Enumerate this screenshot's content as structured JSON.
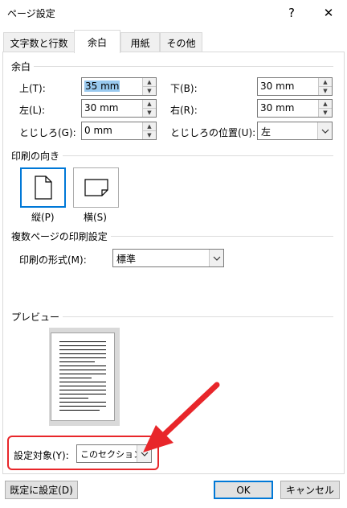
{
  "window": {
    "title": "ページ設定",
    "help_label": "?",
    "close_label": "✕"
  },
  "tabs": [
    {
      "label": "文字数と行数",
      "active": false
    },
    {
      "label": "余白",
      "active": true
    },
    {
      "label": "用紙",
      "active": false
    },
    {
      "label": "その他",
      "active": false
    }
  ],
  "margins": {
    "section_label": "余白",
    "top": {
      "label": "上(T):",
      "value": "35 mm"
    },
    "bottom": {
      "label": "下(B):",
      "value": "30 mm"
    },
    "left": {
      "label": "左(L):",
      "value": "30 mm"
    },
    "right": {
      "label": "右(R):",
      "value": "30 mm"
    },
    "gutter": {
      "label": "とじしろ(G):",
      "value": "0 mm"
    },
    "gutter_pos": {
      "label": "とじしろの位置(U):",
      "value": "左"
    }
  },
  "orientation": {
    "section_label": "印刷の向き",
    "portrait_label": "縦(P)",
    "landscape_label": "横(S)",
    "selected": "portrait"
  },
  "pages": {
    "section_label": "複数ページの印刷設定",
    "format_label": "印刷の形式(M):",
    "format_value": "標準"
  },
  "preview": {
    "section_label": "プレビュー"
  },
  "apply_to": {
    "label": "設定対象(Y):",
    "value": "このセクション"
  },
  "footer": {
    "default_label": "既定に設定(D)",
    "ok_label": "OK",
    "cancel_label": "キャンセル"
  },
  "colors": {
    "accent": "#0078d7",
    "highlight": "#e8262a",
    "selection": "#99c9ef"
  }
}
